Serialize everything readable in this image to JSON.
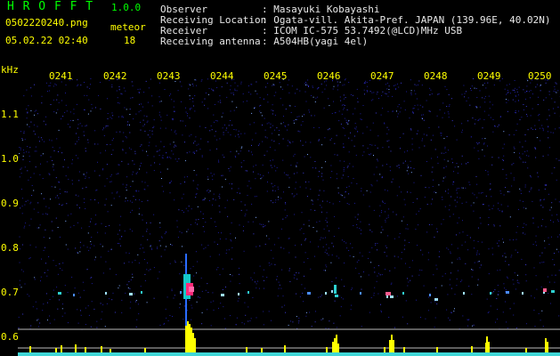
{
  "app": {
    "name": "H R O F F T",
    "version": "1.0.0"
  },
  "file": {
    "name": "0502220240.png",
    "datetime": "05.02.22 02:40"
  },
  "meteor": {
    "label": "meteor",
    "count": "18"
  },
  "info": {
    "labels": [
      "Observer",
      "Receiving Location",
      "Receiver",
      "Receiving antenna"
    ],
    "values": [
      ": Masayuki Kobayashi",
      ": Ogata-vill. Akita-Pref. JAPAN (139.96E, 40.02N)",
      ": ICOM IC-575 53.7492(@LCD)MHz USB",
      ": A504HB(yagi 4el)"
    ]
  },
  "axis": {
    "unit": "kHz",
    "y_labels": [
      "1.1",
      "1.0",
      "0.9",
      "0.8",
      "0.7",
      "0.6"
    ],
    "x_labels": [
      "0241",
      "0242",
      "0243",
      "0244",
      "0245",
      "0246",
      "0247",
      "0248",
      "0249",
      "0250"
    ]
  },
  "colors": {
    "header": "#e8e8e8",
    "accent": "#00ff00",
    "axis": "#ffff00",
    "noise": "#1a1a8c"
  }
}
